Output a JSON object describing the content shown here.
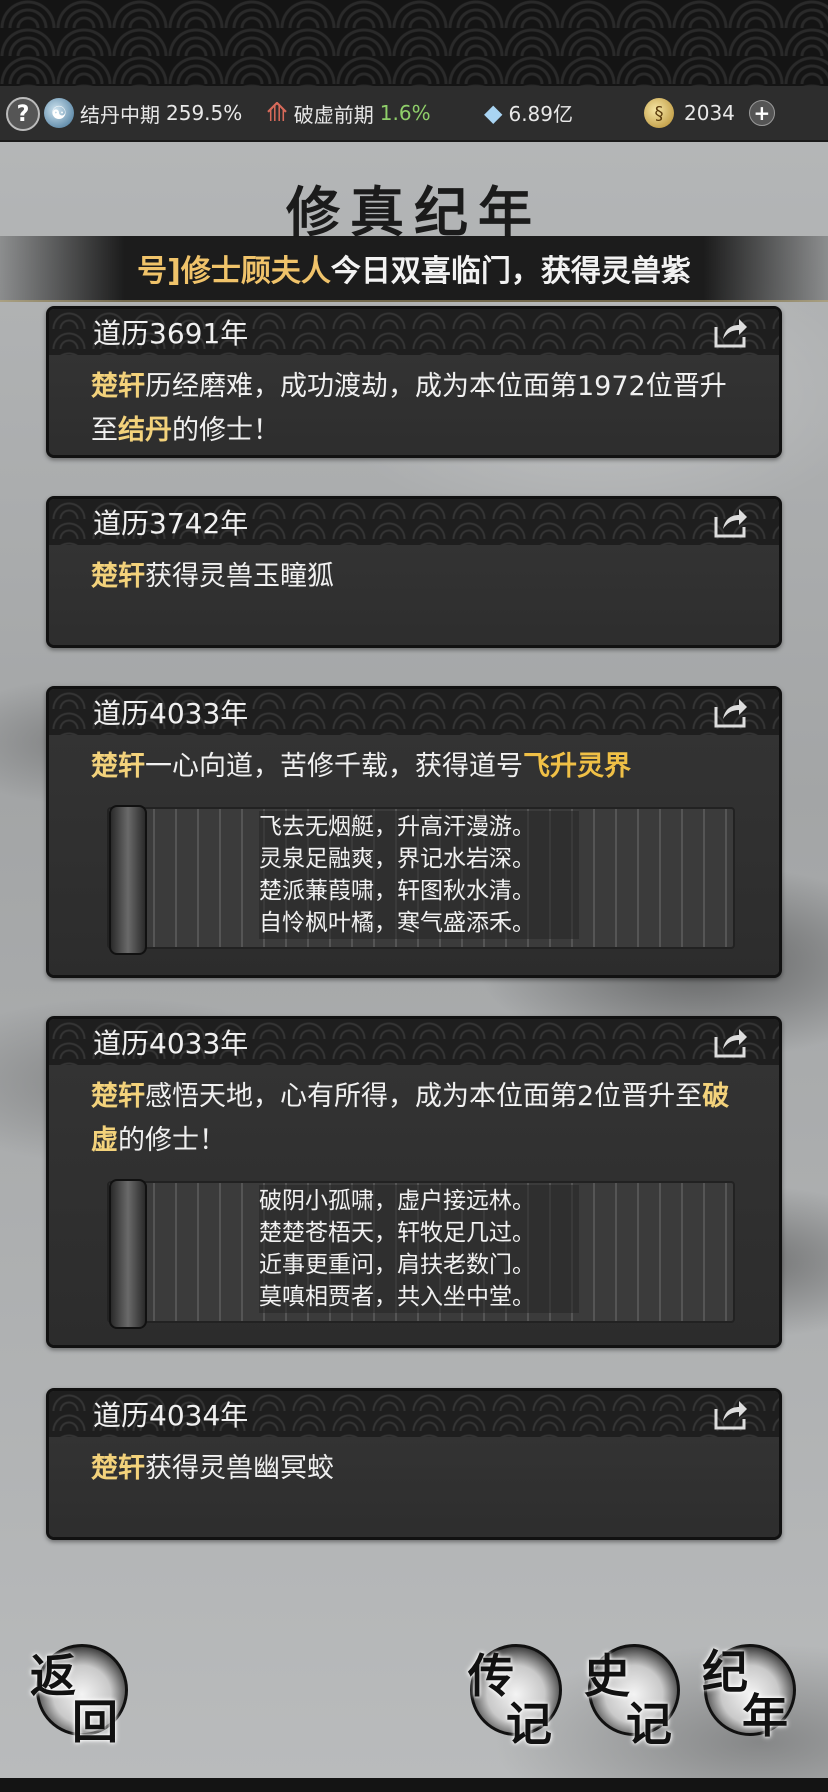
{
  "status_bar": {
    "help_label": "?",
    "realm_label": "结丹中期",
    "realm_value": "259.5%",
    "break_label": "破虚前期",
    "break_value": "1.6%",
    "stone_value": "6.89亿",
    "coin_value": "2034",
    "plus_label": "+"
  },
  "page_title": "修真纪年",
  "marquee": {
    "prefix": "号]修士",
    "name": "顾夫人",
    "text": "今日双喜临门，获得灵兽",
    "tail": "紫"
  },
  "events": [
    {
      "year": "道历3691年",
      "parts": [
        {
          "text": "楚轩",
          "style": "hl"
        },
        {
          "text": "历经磨难，成功渡劫，成为本位面第1972位晋升至",
          "style": ""
        },
        {
          "text": "结丹",
          "style": "hl"
        },
        {
          "text": "的修士！",
          "style": ""
        }
      ]
    },
    {
      "year": "道历3742年",
      "parts": [
        {
          "text": "楚轩",
          "style": "hl"
        },
        {
          "text": "获得灵兽玉瞳狐",
          "style": ""
        }
      ]
    },
    {
      "year": "道历4033年",
      "parts": [
        {
          "text": "楚轩",
          "style": "hl"
        },
        {
          "text": "一心向道，苦修千载，获得道号",
          "style": ""
        },
        {
          "text": "飞升灵界",
          "style": "hl2"
        }
      ],
      "poem": [
        "飞去无烟艇，升高汗漫游。",
        "灵泉足融爽，界记水岩深。",
        "楚派蒹葭啸，轩图秋水清。",
        "自怜枫叶橘，寒气盛添禾。"
      ]
    },
    {
      "year": "道历4033年",
      "parts": [
        {
          "text": "楚轩",
          "style": "hl"
        },
        {
          "text": "感悟天地，心有所得，成为本位面第2位晋升至",
          "style": ""
        },
        {
          "text": "破虚",
          "style": "hl"
        },
        {
          "text": "的修士！",
          "style": ""
        }
      ],
      "poem": [
        "破阴小孤啸，虚户接远林。",
        "楚楚苍梧天，轩牧足几过。",
        "近事更重问，肩扶老数门。",
        "莫嗔相贾者，共入坐中堂。"
      ]
    },
    {
      "year": "道历4034年",
      "parts": [
        {
          "text": "楚轩",
          "style": "hl"
        },
        {
          "text": "获得灵兽幽冥蛟",
          "style": ""
        }
      ]
    }
  ],
  "bottom_nav": {
    "back": [
      "返",
      "回"
    ],
    "biography": [
      "传",
      "记"
    ],
    "history": [
      "史",
      "记"
    ],
    "chronicle": [
      "纪",
      "年"
    ]
  },
  "icons": [
    "help-icon",
    "realm-icon",
    "breakthrough-icon",
    "spirit-stone-icon",
    "coin-icon",
    "plus-icon",
    "share-icon"
  ]
}
